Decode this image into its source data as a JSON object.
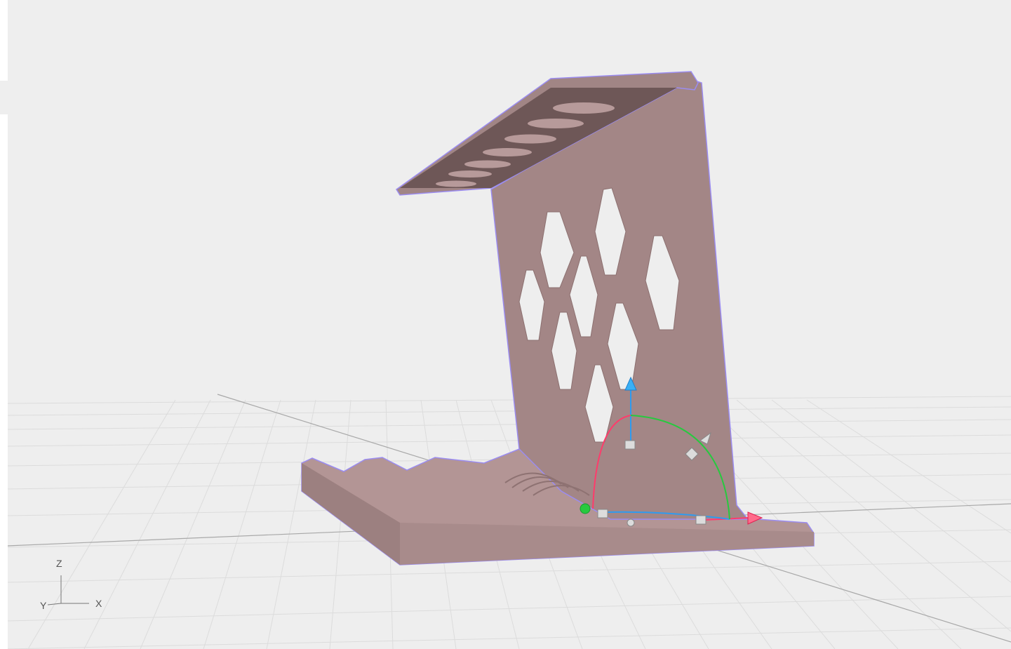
{
  "viewport": {
    "background": "#eeeeee",
    "model_color": "#a18585",
    "selection_outline_color": "#9b8cf0",
    "grid_color": "#d9d9d9"
  },
  "axis_triad": {
    "x_label": "X",
    "y_label": "Y",
    "z_label": "Z"
  },
  "gizmo": {
    "translate_x_color": "#ff3b6b",
    "translate_y_color": "#27c93f",
    "translate_z_color": "#2e9bf0",
    "icons": [
      "arrow-x-icon",
      "arrow-z-icon",
      "rotate-handle-icon",
      "plane-handle-icon",
      "scale-handle-icon"
    ]
  }
}
